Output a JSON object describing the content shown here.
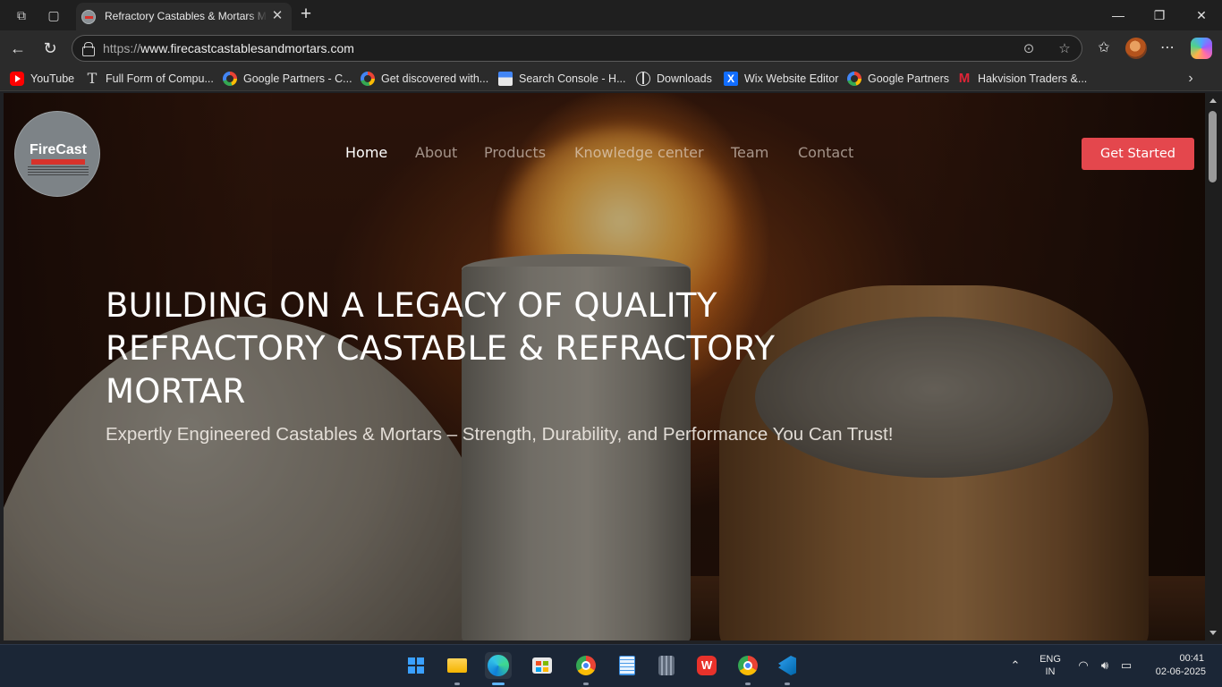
{
  "browser": {
    "tab_title": "Refractory Castables & Mortars M",
    "url_scheme": "https://",
    "url_host": "www.firecastcastablesandmortars.com",
    "bookmarks": [
      {
        "label": "YouTube",
        "icon": "youtube-icon"
      },
      {
        "label": "Full Form of Compu...",
        "icon": "t-icon"
      },
      {
        "label": "Google Partners - C...",
        "icon": "google-icon"
      },
      {
        "label": "Get discovered with...",
        "icon": "google-icon"
      },
      {
        "label": "Search Console - H...",
        "icon": "search-console-icon"
      },
      {
        "label": "Downloads",
        "icon": "globe-icon"
      },
      {
        "label": "Wix Website Editor",
        "icon": "wix-icon"
      },
      {
        "label": "Google Partners",
        "icon": "google-icon"
      },
      {
        "label": "Hakvision Traders &...",
        "icon": "m-icon"
      }
    ]
  },
  "site": {
    "logo": {
      "word1": "Fire",
      "word2": "Cast",
      "tagline": "Castable and Mortar"
    },
    "nav": [
      "Home",
      "About",
      "Products",
      "Knowledge center",
      "Team",
      "Contact"
    ],
    "active_nav": "Home",
    "cta_label": "Get Started",
    "hero_line1": "BUILDING ON A LEGACY OF QUALITY",
    "hero_line2": "REFRACTORY CASTABLE & REFRACTORY",
    "hero_line3": "MORTAR",
    "hero_subtitle": "Expertly Engineered Castables & Mortars – Strength, Durability, and Performance You Can Trust!",
    "accent_color": "#e4474d"
  },
  "taskbar": {
    "lang_line1": "ENG",
    "lang_line2": "IN",
    "time": "00:41",
    "date": "02-06-2025"
  }
}
